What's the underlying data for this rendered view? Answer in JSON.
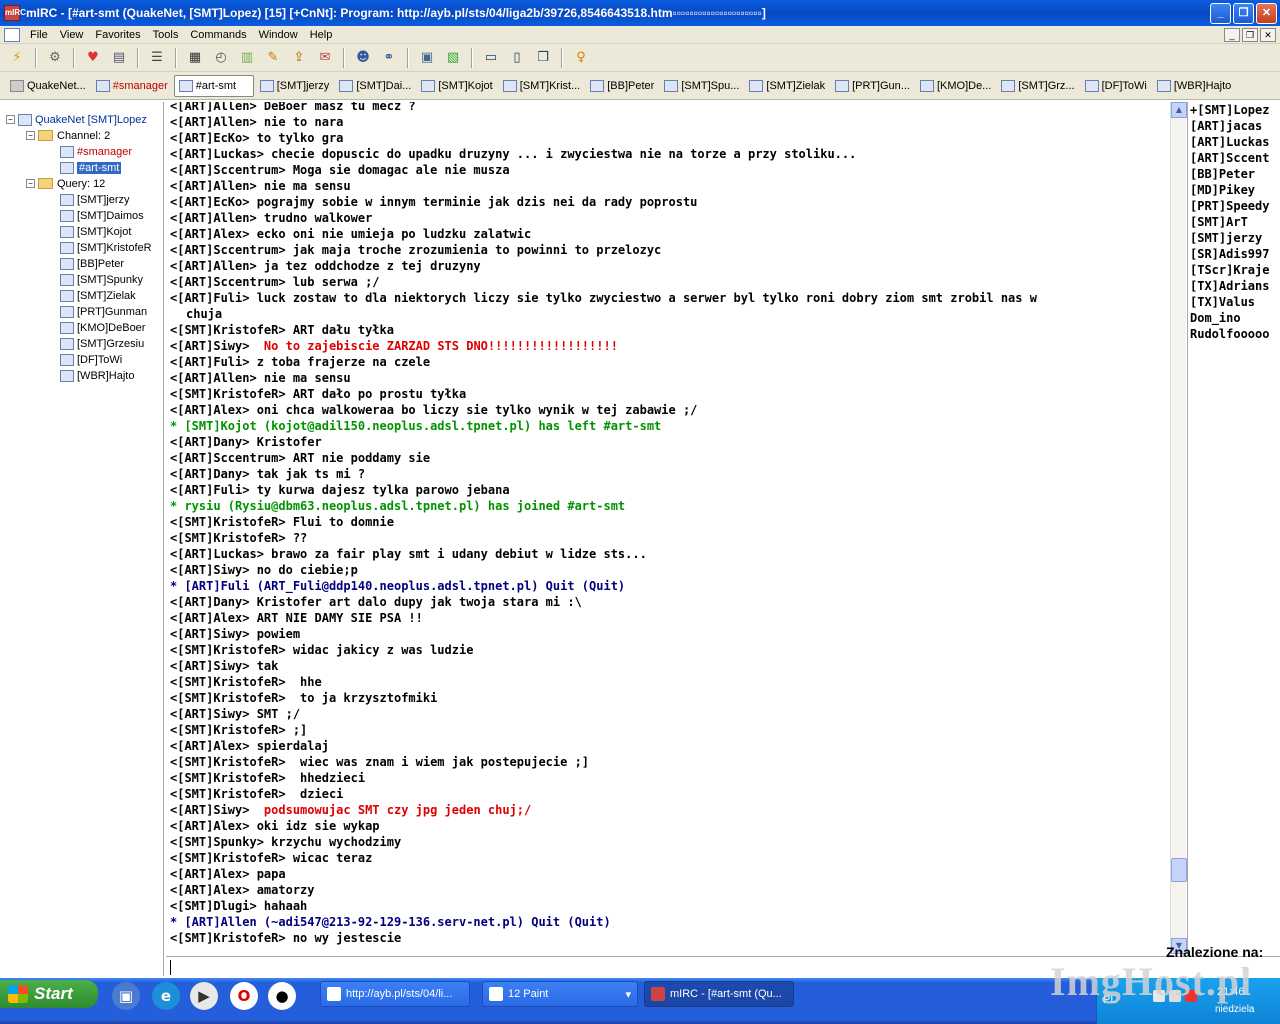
{
  "window": {
    "title": "mIRC - [#art-smt (QuakeNet, [SMT]Lopez) [15] [+CnNt]: Program: http://ayb.pl/sts/04/liga2b/39726,8546643518.htm▫▫▫▫▫▫▫▫▫▫▫▫▫▫▫▫▫▫▫▫▫]",
    "app_icon_label": "mIRC",
    "min": "_",
    "max": "❐",
    "close": "✕"
  },
  "menu": [
    "File",
    "View",
    "Favorites",
    "Tools",
    "Commands",
    "Window",
    "Help"
  ],
  "mdi_buttons": [
    "_",
    "❐",
    "✕"
  ],
  "toolbar_icons": [
    "connect-icon",
    "options-icon",
    "favorites-icon",
    "address-book-icon",
    "channels-list-icon",
    "scripts-editor-icon",
    "remote-icon",
    "timer-icon",
    "colors-icon",
    "dcc-send-icon",
    "dcc-chat-icon",
    "notify-icon",
    "urls-icon",
    "channel-central-icon",
    "log-viewer-icon",
    "received-files-icon",
    "tile-horizontal-icon",
    "tile-vertical-icon",
    "cascade-icon",
    "help-icon"
  ],
  "switchbar": [
    {
      "label": "QuakeNet...",
      "type": "server"
    },
    {
      "label": "#smanager",
      "type": "channel",
      "red": true
    },
    {
      "label": "#art-smt",
      "type": "channel",
      "active": true
    },
    {
      "label": "[SMT]jerzy",
      "type": "query"
    },
    {
      "label": "[SMT]Dai...",
      "type": "query"
    },
    {
      "label": "[SMT]Kojot",
      "type": "query"
    },
    {
      "label": "[SMT]Krist...",
      "type": "query"
    },
    {
      "label": "[BB]Peter",
      "type": "query"
    },
    {
      "label": "[SMT]Spu...",
      "type": "query"
    },
    {
      "label": "[SMT]Zielak",
      "type": "query"
    },
    {
      "label": "[PRT]Gun...",
      "type": "query"
    },
    {
      "label": "[KMO]De...",
      "type": "query"
    },
    {
      "label": "[SMT]Grz...",
      "type": "query"
    },
    {
      "label": "[DF]ToWi",
      "type": "query"
    },
    {
      "label": "[WBR]Hajto",
      "type": "query"
    }
  ],
  "tree": {
    "server": "QuakeNet [SMT]Lopez",
    "channel_folder": "Channel: 2",
    "channels": [
      {
        "label": "#smanager",
        "red": true
      },
      {
        "label": "#art-smt",
        "selected": true
      }
    ],
    "query_folder": "Query: 12",
    "queries": [
      "[SMT]jerzy",
      "[SMT]Daimos",
      "[SMT]Kojot",
      "[SMT]KristofeR",
      "[BB]Peter",
      "[SMT]Spunky",
      "[SMT]Zielak",
      "[PRT]Gunman",
      "[KMO]DeBoer",
      "[SMT]Grzesiu",
      "[DF]ToWi",
      "[WBR]Hajto"
    ]
  },
  "chat": [
    {
      "text": "<[ART]Allen> DeBoer masz tu mecz ?"
    },
    {
      "text": "<[ART]Allen> nie to nara"
    },
    {
      "text": "<[ART]EcKo> to tylko gra"
    },
    {
      "text": "<[ART]Luckas> checie dopuscic do upadku druzyny ... i zwyciestwa nie na torze a przy stoliku..."
    },
    {
      "text": "<[ART]Sccentrum> Moga sie domagac ale nie musza"
    },
    {
      "text": "<[ART]Allen> nie ma sensu"
    },
    {
      "text": "<[ART]EcKo> pograjmy sobie w innym terminie jak dzis nei da rady poprostu"
    },
    {
      "text": "<[ART]Allen> trudno walkower"
    },
    {
      "text": "<[ART]Alex> ecko oni nie umieja po ludzku zalatwic"
    },
    {
      "text": "<[ART]Sccentrum> jak maja troche zrozumienia to powinni to przelozyc"
    },
    {
      "text": "<[ART]Allen> ja tez oddchodze z tej druzyny"
    },
    {
      "text": "<[ART]Sccentrum> lub serwa ;/"
    },
    {
      "text": "<[ART]Fuli> luck zostaw to dla niektorych liczy sie tylko zwyciestwo a serwer byl tylko roni dobry ziom smt zrobil nas w"
    },
    {
      "text": "chuja",
      "cont": true
    },
    {
      "text": "<[SMT]KristofeR> ART dału tyłka"
    },
    {
      "text": "<[ART]Siwy> ",
      "red": " No to zajebiscie ZARZAD STS DNO!!!!!!!!!!!!!!!!!!"
    },
    {
      "text": "<[ART]Fuli> z toba frajerze na czele"
    },
    {
      "text": "<[ART]Allen> nie ma sensu"
    },
    {
      "text": "<[SMT]KristofeR> ART dało po prostu tyłka"
    },
    {
      "text": "<[ART]Alex> oni chca walkoweraa bo liczy sie tylko wynik w tej zabawie ;/"
    },
    {
      "text": "* [SMT]Kojot (kojot@adil150.neoplus.adsl.tpnet.pl) has left #art-smt",
      "style": "green"
    },
    {
      "text": "<[ART]Dany> Kristofer"
    },
    {
      "text": "<[ART]Sccentrum> ART nie poddamy sie"
    },
    {
      "text": "<[ART]Dany> tak jak ts mi ?"
    },
    {
      "text": "<[ART]Fuli> ty kurwa dajesz tylka parowo jebana"
    },
    {
      "text": "* rysiu (Rysiu@dbm63.neoplus.adsl.tpnet.pl) has joined #art-smt",
      "style": "green"
    },
    {
      "text": "<[SMT]KristofeR> Flui to domnie"
    },
    {
      "text": "<[SMT]KristofeR> ??"
    },
    {
      "text": "<[ART]Luckas> brawo za fair play smt i udany debiut w lidze sts..."
    },
    {
      "text": "<[ART]Siwy> no do ciebie;p"
    },
    {
      "text": "* [ART]Fuli (ART_Fuli@ddp140.neoplus.adsl.tpnet.pl) Quit (Quit)",
      "style": "navy"
    },
    {
      "text": "<[ART]Dany> Kristofer art dalo dupy jak twoja stara mi :\\"
    },
    {
      "text": "<[ART]Alex> ART NIE DAMY SIE PSA !!"
    },
    {
      "text": "<[ART]Siwy> powiem"
    },
    {
      "text": "<[SMT]KristofeR> widac jakicy z was ludzie"
    },
    {
      "text": "<[ART]Siwy> tak"
    },
    {
      "text": "<[SMT]KristofeR>  hhe"
    },
    {
      "text": "<[SMT]KristofeR>  to ja krzysztofmiki"
    },
    {
      "text": "<[ART]Siwy> SMT ;/"
    },
    {
      "text": "<[SMT]KristofeR> ;]"
    },
    {
      "text": "<[ART]Alex> spierdalaj"
    },
    {
      "text": "<[SMT]KristofeR>  wiec was znam i wiem jak postepujecie ;]"
    },
    {
      "text": "<[SMT]KristofeR>  hhedzieci"
    },
    {
      "text": "<[SMT]KristofeR>  dzieci"
    },
    {
      "text": "<[ART]Siwy> ",
      "red": " podsumowujac SMT czy jpg jeden chuj;/"
    },
    {
      "text": "<[ART]Alex> oki idz sie wykap"
    },
    {
      "text": "<[SMT]Spunky> krzychu wychodzimy"
    },
    {
      "text": "<[SMT]KristofeR> wicac teraz"
    },
    {
      "text": "<[ART]Alex> papa"
    },
    {
      "text": "<[ART]Alex> amatorzy"
    },
    {
      "text": "<[SMT]Dlugi> hahaah"
    },
    {
      "text": "* [ART]Allen (~adi547@213-92-129-136.serv-net.pl) Quit (Quit)",
      "style": "navy"
    },
    {
      "text": "<[SMT]KristofeR> no wy jestescie"
    }
  ],
  "nicklist": [
    "+[SMT]Lopez",
    "[ART]jacas",
    "[ART]Luckas",
    "[ART]Sccent",
    "[BB]Peter",
    "[MD]Pikey",
    "[PRT]Speedy",
    "[SMT]ArT",
    "[SMT]jerzy",
    "[SR]Adis997",
    "[TScr]Kraje",
    "[TX]Adrians",
    "[TX]Valus",
    "Dom_ino",
    "Rudolfooooo"
  ],
  "scrollbar": {
    "up": "▲",
    "down": "▼"
  },
  "editbox": {
    "value": ""
  },
  "taskbar": {
    "start": "Start",
    "tasks": [
      {
        "label": "http://ayb.pl/sts/04/li...",
        "icon": "ie-icon"
      },
      {
        "label": "12 Paint",
        "icon": "paint-icon"
      },
      {
        "label": "mIRC - [#art-smt (Qu...",
        "icon": "mirc-icon",
        "active": true
      }
    ],
    "tray": {
      "lang": "PL",
      "time": "21:46",
      "day": "niedziela"
    }
  },
  "overlay": {
    "found": "Znalezione na:",
    "watermark": "ImgHost.pl"
  }
}
